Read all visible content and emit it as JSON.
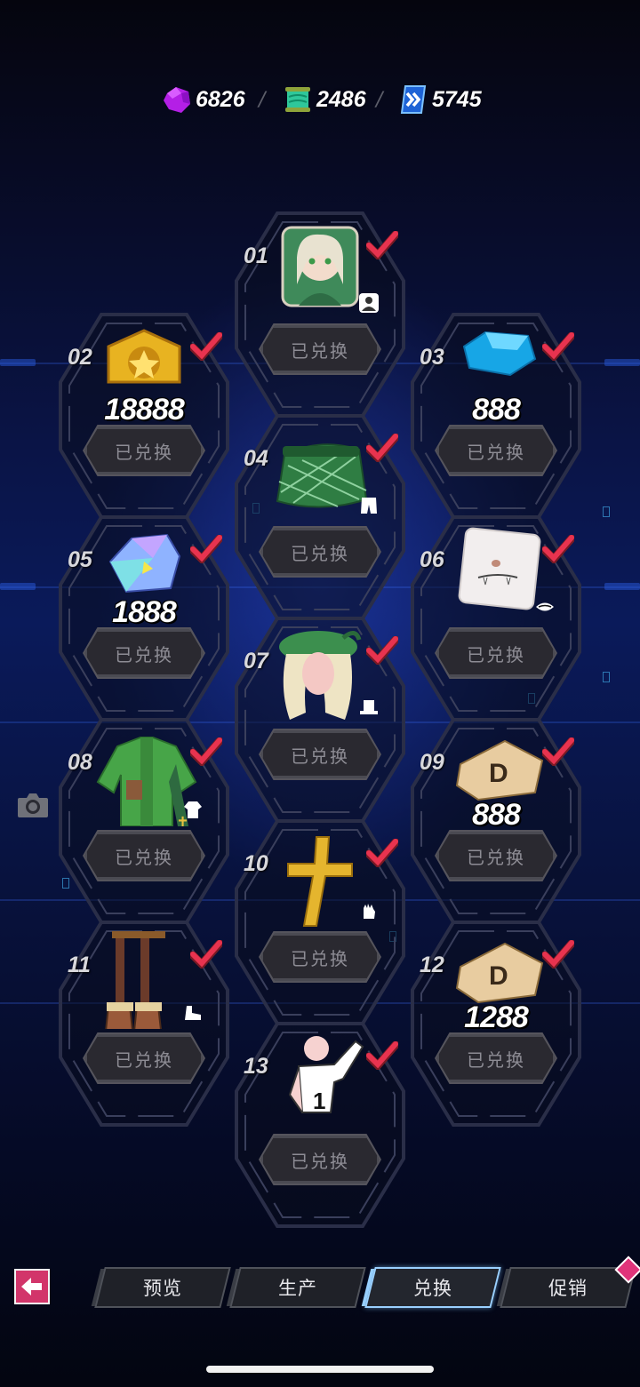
{
  "currencies": [
    {
      "name": "crystal",
      "icon": "purple-crystal-icon",
      "value": "6826"
    },
    {
      "name": "scroll",
      "icon": "green-scroll-icon",
      "value": "2486"
    },
    {
      "name": "ticket",
      "icon": "blue-chevron-ticket-icon",
      "value": "5745"
    }
  ],
  "rewards": [
    {
      "number": "01",
      "item": "character-portrait",
      "qty": "",
      "button": "已兑换",
      "type_icon": "character-type-icon",
      "claimed": true
    },
    {
      "number": "02",
      "item": "gold-star-badge",
      "qty": "18888",
      "button": "已兑换",
      "type_icon": "",
      "claimed": true
    },
    {
      "number": "03",
      "item": "blue-gem",
      "qty": "888",
      "button": "已兑换",
      "type_icon": "",
      "claimed": true
    },
    {
      "number": "04",
      "item": "green-plaid-skirt",
      "qty": "",
      "button": "已兑换",
      "type_icon": "pants-type-icon",
      "claimed": true
    },
    {
      "number": "05",
      "item": "holo-crystal",
      "qty": "1888",
      "button": "已兑换",
      "type_icon": "",
      "claimed": true
    },
    {
      "number": "06",
      "item": "face-card",
      "qty": "",
      "button": "已兑换",
      "type_icon": "mouth-type-icon",
      "claimed": true
    },
    {
      "number": "07",
      "item": "beret-hair",
      "qty": "",
      "button": "已兑换",
      "type_icon": "hat-type-icon",
      "claimed": true
    },
    {
      "number": "08",
      "item": "green-coat",
      "qty": "",
      "button": "已兑换",
      "type_icon": "top-type-icon",
      "claimed": true
    },
    {
      "number": "09",
      "item": "d-ticket",
      "qty": "888",
      "button": "已兑换",
      "type_icon": "",
      "claimed": true
    },
    {
      "number": "10",
      "item": "gold-cross",
      "qty": "",
      "button": "已兑换",
      "type_icon": "glove-type-icon",
      "claimed": true
    },
    {
      "number": "11",
      "item": "brown-boots",
      "qty": "",
      "button": "已兑换",
      "type_icon": "shoe-type-icon",
      "claimed": true
    },
    {
      "number": "12",
      "item": "d-ticket",
      "qty": "1288",
      "button": "已兑换",
      "type_icon": "",
      "claimed": true
    },
    {
      "number": "13",
      "item": "pose-action",
      "qty": "",
      "button": "已兑换",
      "type_icon": "",
      "claimed": true
    }
  ],
  "nav": {
    "back_icon": "back-arrow-icon",
    "tabs": [
      {
        "label": "预览",
        "active": false
      },
      {
        "label": "生产",
        "active": false
      },
      {
        "label": "兑换",
        "active": true
      },
      {
        "label": "促销",
        "active": false
      }
    ]
  },
  "colors": {
    "check": "#e8334f",
    "accent": "#d2356a",
    "active_tab_border": "#9ad0ff"
  }
}
